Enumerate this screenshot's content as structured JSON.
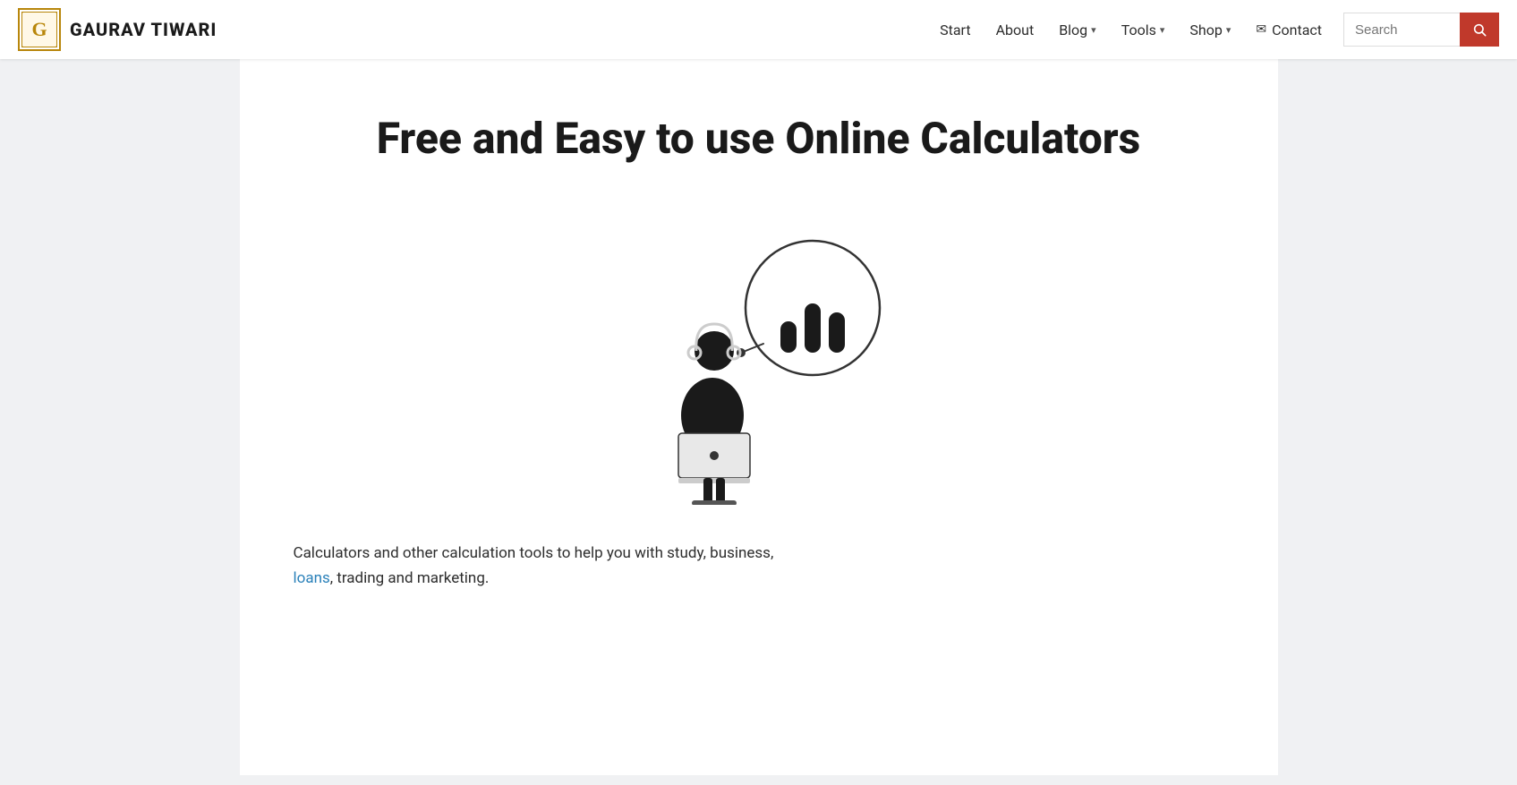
{
  "header": {
    "logo_icon": "G",
    "logo_text": "GAURAV TIWARI",
    "nav": {
      "start": "Start",
      "about": "About",
      "blog": "Blog",
      "tools": "Tools",
      "shop": "Shop",
      "contact": "Contact",
      "search_placeholder": "Search"
    }
  },
  "main": {
    "title": "Free and Easy to use Online Calculators",
    "description_part1": "Calculators and other calculation tools to help you with study, business,",
    "description_part2_prefix": "",
    "description_link_text": "loans",
    "description_part3": ", trading and marketing."
  },
  "illustration": {
    "alt": "Person using calculator illustration"
  }
}
